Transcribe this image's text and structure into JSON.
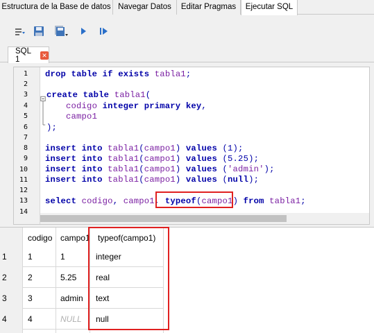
{
  "tabs": [
    {
      "label": "Estructura de la Base de datos"
    },
    {
      "label": "Navegar Datos"
    },
    {
      "label": "Editar Pragmas"
    },
    {
      "label": "Ejecutar SQL"
    }
  ],
  "editor_tab": {
    "label": "SQL 1",
    "close": "✕"
  },
  "code": {
    "line_numbers": [
      "1",
      "2",
      "3",
      "4",
      "5",
      "6",
      "7",
      "8",
      "9",
      "10",
      "11",
      "12",
      "13",
      "14"
    ],
    "l1": {
      "kw1": "drop table if exists",
      "id": "tabla1",
      "pl": ";"
    },
    "l3": {
      "kw": "create table",
      "id": "tabla1",
      "pl": "("
    },
    "l4": {
      "id": "codigo",
      "kw": "integer primary key",
      "pl": ","
    },
    "l5": {
      "id": "campo1"
    },
    "l6": {
      "pl": ");"
    },
    "inserts": [
      {
        "kw": "insert into",
        "id1": "tabla1",
        "p1": "(",
        "id2": "campo1",
        "p2": ")",
        "kw2": "values",
        "p3": "(",
        "val": "1",
        "p4": ");"
      },
      {
        "kw": "insert into",
        "id1": "tabla1",
        "p1": "(",
        "id2": "campo1",
        "p2": ")",
        "kw2": "values",
        "p3": "(",
        "val": "5.25",
        "p4": ");"
      },
      {
        "kw": "insert into",
        "id1": "tabla1",
        "p1": "(",
        "id2": "campo1",
        "p2": ")",
        "kw2": "values",
        "p3": "(",
        "val": "'admin'",
        "p4": ");"
      },
      {
        "kw": "insert into",
        "id1": "tabla1",
        "p1": "(",
        "id2": "campo1",
        "p2": ")",
        "kw2": "values",
        "p3": "(",
        "val": "null",
        "p4": ");"
      }
    ],
    "l13": {
      "kw1": "select",
      "id1": "codigo",
      "p1": ",",
      "id2": "campo1",
      "p2": ",",
      "fn": "typeof",
      "p3": "(",
      "id3": "campo1",
      "p4": ")",
      "kw2": "from",
      "id4": "tabla1",
      "p5": ";"
    }
  },
  "results": {
    "columns": [
      "codigo",
      "campo1",
      "typeof(campo1)"
    ],
    "rows": [
      {
        "n": "1",
        "codigo": "1",
        "campo1": "1",
        "typeof": "integer"
      },
      {
        "n": "2",
        "codigo": "2",
        "campo1": "5.25",
        "typeof": "real"
      },
      {
        "n": "3",
        "codigo": "3",
        "campo1": "admin",
        "typeof": "text"
      },
      {
        "n": "4",
        "codigo": "4",
        "campo1": "NULL",
        "typeof": "null"
      }
    ]
  },
  "colors": {
    "highlight": "#e02020",
    "keyword": "#0000a8",
    "identifier": "#7a1fa2"
  },
  "icons": [
    "open-tabs-icon",
    "save-sql-icon",
    "save-results-icon",
    "execute-all-icon",
    "execute-current-icon"
  ]
}
